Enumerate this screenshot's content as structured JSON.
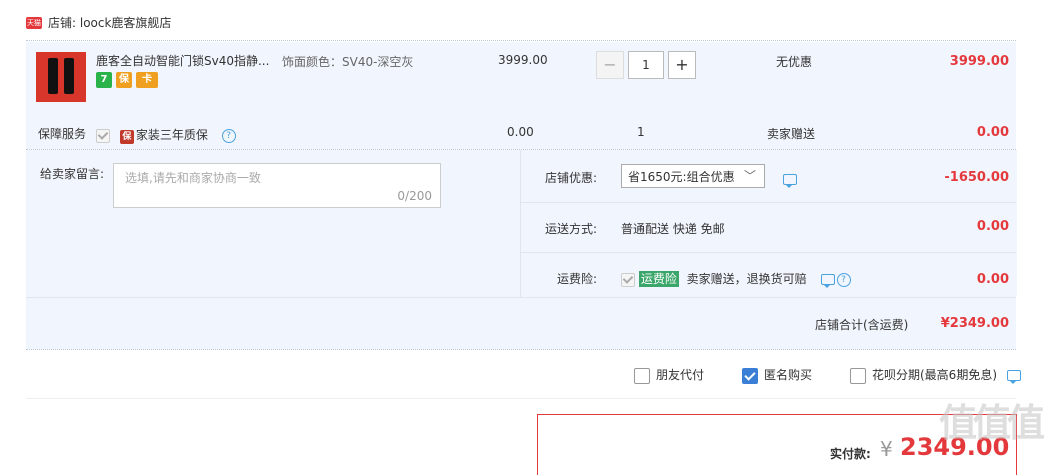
{
  "store": {
    "tag": "天猫",
    "name": "店铺: loock鹿客旗舰店"
  },
  "item": {
    "title": "鹿客全自动智能门锁Sv40指静...",
    "spec": "饰面颜色：SV40-深空灰",
    "price": "3999.00",
    "quantity": "1",
    "discount": "无优惠",
    "subtotal": "3999.00",
    "badges": [
      "7",
      "保",
      "卡"
    ]
  },
  "service": {
    "label": "保障服务",
    "tag": "保",
    "name": "家装三年质保",
    "price": "0.00",
    "quantity": "1",
    "gift": "卖家赠送",
    "subtotal": "0.00"
  },
  "message": {
    "label": "给卖家留言:",
    "placeholder": "选填,请先和商家协商一致",
    "counter": "0/200"
  },
  "shop_discount": {
    "label": "店铺优惠:",
    "selected": "省1650元:组合优惠",
    "amount": "-1650.00"
  },
  "shipping": {
    "label": "运送方式:",
    "value": "普通配送 快递 免邮",
    "amount": "0.00"
  },
  "insurance": {
    "label": "运费险:",
    "tag": "运费险",
    "text": "卖家赠送，退换货可赔",
    "amount": "0.00"
  },
  "shop_total": {
    "label": "店铺合计(含运费)",
    "amount": "¥2349.00"
  },
  "options": {
    "friend_pay": "朋友代付",
    "anonymous": "匿名购买",
    "huabei": "花呗分期(最高6期免息)"
  },
  "payment": {
    "label": "实付款:",
    "symbol": "¥",
    "amount": "2349.00"
  },
  "watermark": "值值值",
  "colors": {
    "accent": "#e4393c",
    "panel": "#f1f5fd",
    "link": "#4aa3df"
  }
}
